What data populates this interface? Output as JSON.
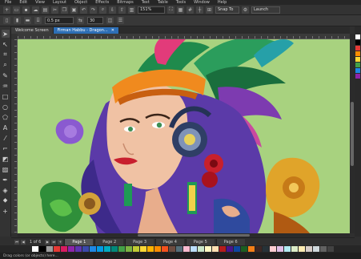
{
  "menu": {
    "items": [
      "File",
      "Edit",
      "View",
      "Layout",
      "Object",
      "Effects",
      "Bitmaps",
      "Text",
      "Table",
      "Tools",
      "Window",
      "Help"
    ]
  },
  "toolbar": {
    "zoom_value": "151%",
    "snap_label": "Snap To",
    "launch_label": "Launch"
  },
  "propbar": {
    "nudge_value": "0.5 px",
    "dup_value": "30"
  },
  "tabs": [
    {
      "label": "Welcome Screen"
    },
    {
      "label": "Firman Habbu - Dragon..."
    }
  ],
  "pagenav": {
    "count": "1 of 6",
    "pages": [
      "Page 1",
      "Page 2",
      "Page 3",
      "Page 4",
      "Page 5",
      "Page 6"
    ]
  },
  "status": {
    "text": "Drag colors (or objects) here..."
  },
  "colors": {
    "canvas_bg": "#a8d27f",
    "accent": "#2d6fb6"
  }
}
